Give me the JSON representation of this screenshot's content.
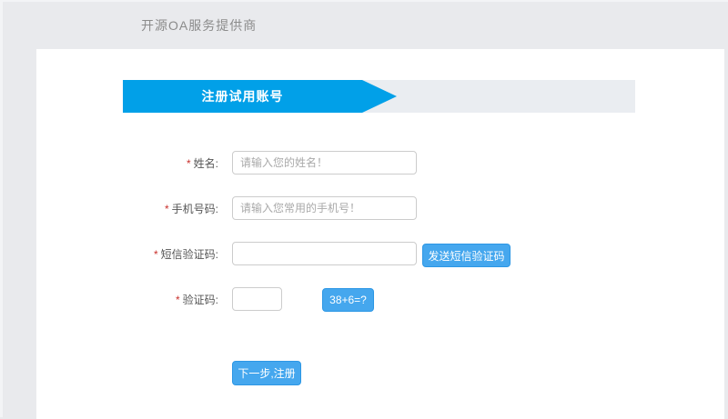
{
  "header": {
    "brand": "开源OA服务提供商"
  },
  "banner": {
    "title": "注册试用账号"
  },
  "form": {
    "required_marker": "*",
    "fields": [
      {
        "label": "姓名:",
        "placeholder": "请输入您的姓名！",
        "value": ""
      },
      {
        "label": "手机号码:",
        "placeholder": "请输入您常用的手机号！",
        "value": ""
      },
      {
        "label": "短信验证码:",
        "placeholder": "",
        "value": "",
        "button": "发送短信验证码"
      },
      {
        "label": "验证码:",
        "placeholder": "",
        "value": "",
        "button": "38+6=?"
      }
    ],
    "submit_label": "下一步,注册"
  },
  "colors": {
    "banner_blue": "#01a0e8",
    "button_blue": "#45a7ee",
    "button_border": "#2d97e5",
    "page_background": "#e9eaed",
    "banner_track": "#eaedf1",
    "required_red": "#c9302c"
  }
}
